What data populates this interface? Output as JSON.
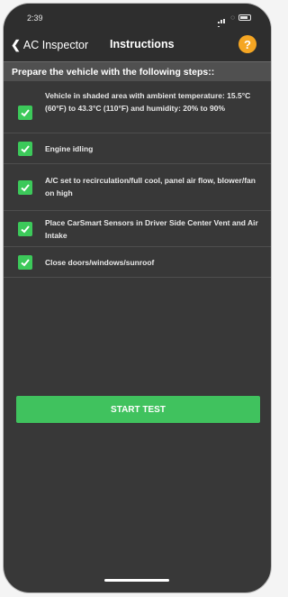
{
  "status_bar": {
    "time": "2:39"
  },
  "nav": {
    "back_label": "AC Inspector",
    "title": "Instructions",
    "help_glyph": "?",
    "help_color": "#f5a623"
  },
  "header": {
    "text": "Prepare the vehicle with the following steps::"
  },
  "steps": [
    {
      "text": "Vehicle in shaded area with ambient temperature: 15.5°C (60°F) to 43.3°C (110°F) and humidity: 20% to 90%",
      "checked": true
    },
    {
      "text": "Engine idling",
      "checked": true
    },
    {
      "text": "A/C set to recirculation/full cool, panel air flow, blower/fan on high",
      "checked": true
    },
    {
      "text": "Place CarSmart Sensors in Driver Side Center Vent and Air Intake",
      "checked": true
    },
    {
      "text": "Close doors/windows/sunroof",
      "checked": true
    }
  ],
  "start_button": {
    "label": "START TEST",
    "color": "#40c25e"
  },
  "theme": {
    "background": "#383838",
    "checkbox_color": "#3cc95a"
  }
}
